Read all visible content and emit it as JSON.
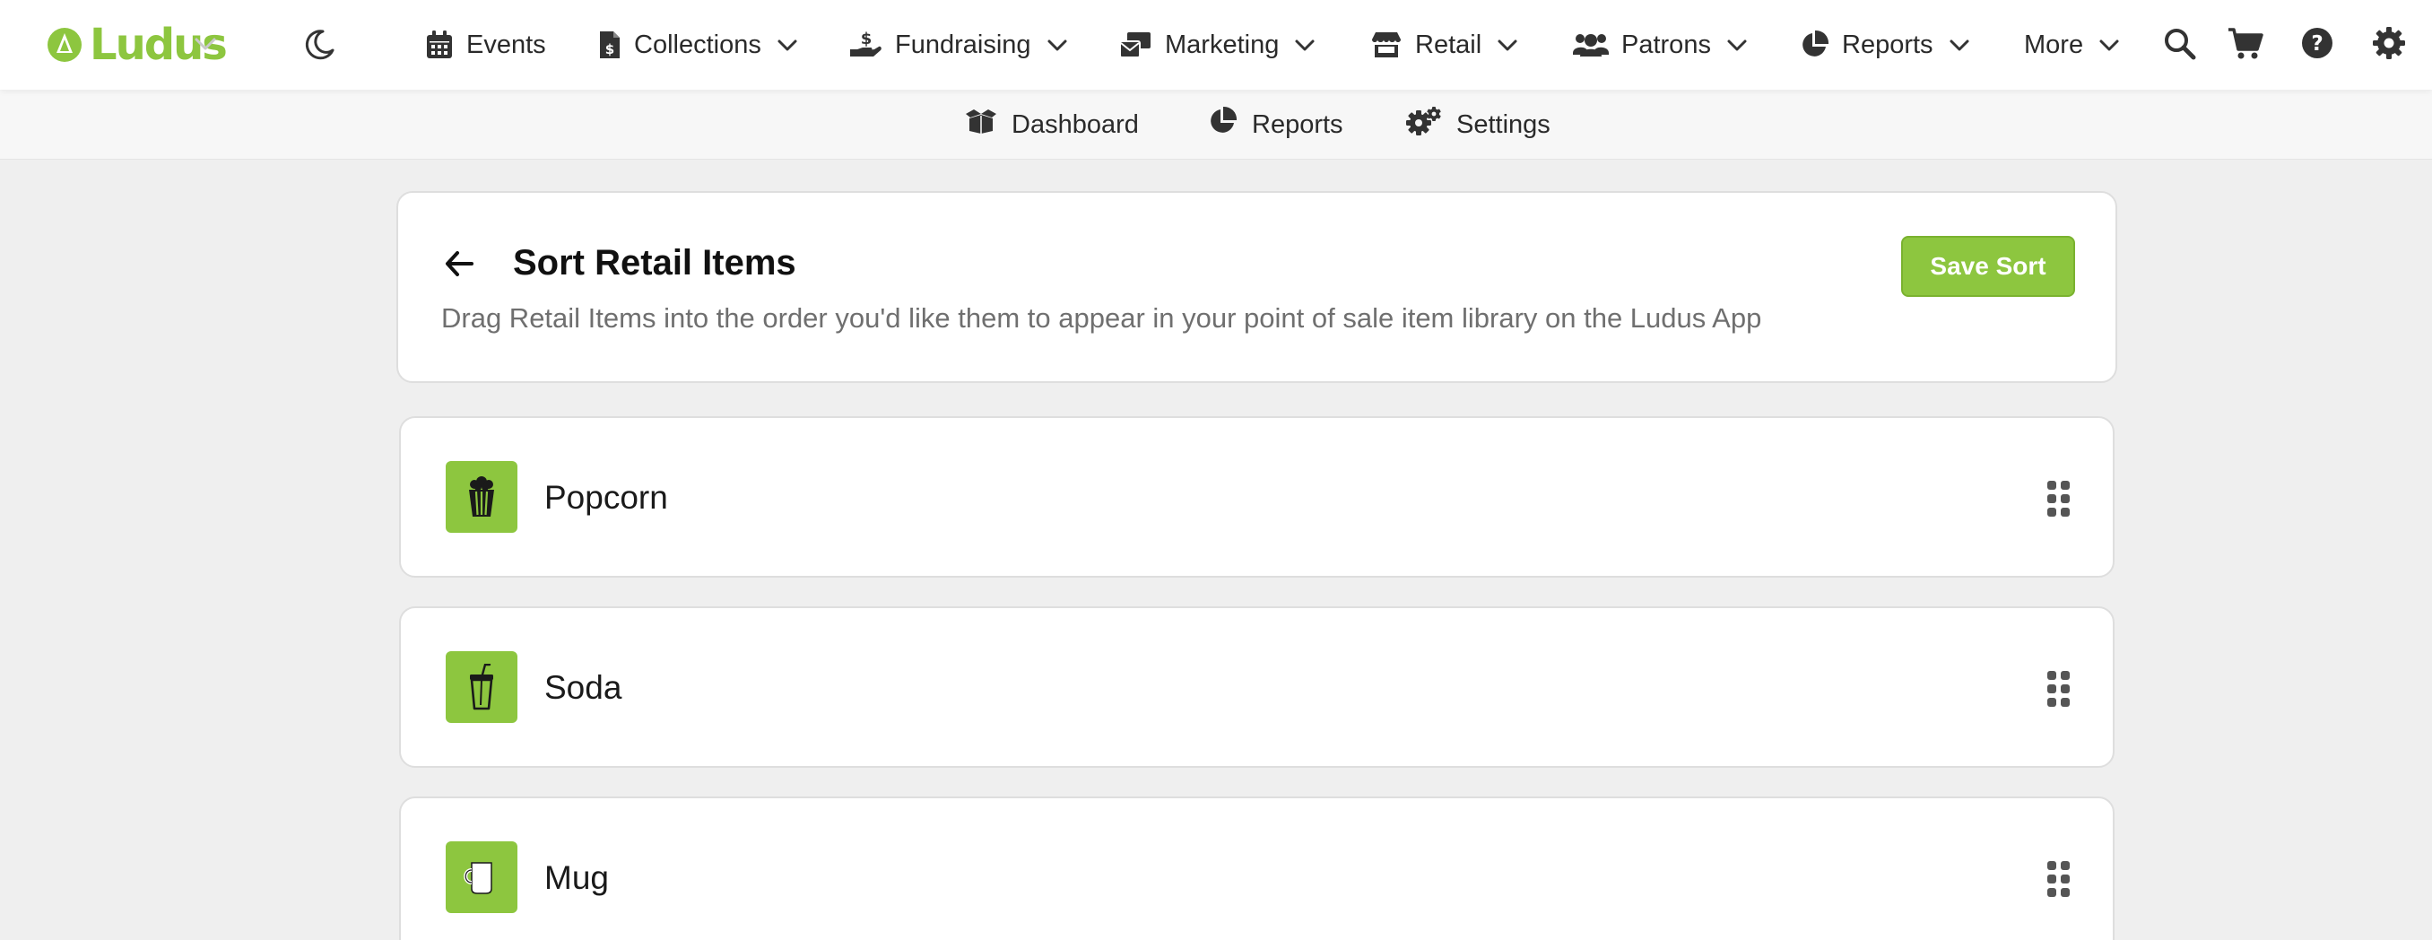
{
  "brand": {
    "name": "Ludus",
    "accent": "#8dc63f"
  },
  "nav": {
    "items": [
      {
        "label": "Events",
        "icon": "calendar-icon",
        "dropdown": false
      },
      {
        "label": "Collections",
        "icon": "invoice-dollar-icon",
        "dropdown": true
      },
      {
        "label": "Fundraising",
        "icon": "hand-holding-dollar-icon",
        "dropdown": true
      },
      {
        "label": "Marketing",
        "icon": "mail-bulk-icon",
        "dropdown": true
      },
      {
        "label": "Retail",
        "icon": "store-icon",
        "dropdown": true
      },
      {
        "label": "Patrons",
        "icon": "users-icon",
        "dropdown": true
      },
      {
        "label": "Reports",
        "icon": "pie-chart-icon",
        "dropdown": true
      },
      {
        "label": "More",
        "icon": "",
        "dropdown": true
      }
    ],
    "utilities": [
      "search-icon",
      "cart-icon",
      "help-icon",
      "gear-icon"
    ]
  },
  "subnav": {
    "items": [
      {
        "label": "Dashboard",
        "icon": "box-open-icon"
      },
      {
        "label": "Reports",
        "icon": "pie-chart-icon"
      },
      {
        "label": "Settings",
        "icon": "cogs-icon"
      }
    ]
  },
  "page": {
    "title": "Sort Retail Items",
    "description": "Drag Retail Items into the order you'd like them to appear in your point of sale item library on the Ludus App",
    "save_label": "Save Sort"
  },
  "items": [
    {
      "name": "Popcorn",
      "icon": "popcorn-icon"
    },
    {
      "name": "Soda",
      "icon": "soda-cup-icon"
    },
    {
      "name": "Mug",
      "icon": "mug-icon"
    }
  ]
}
